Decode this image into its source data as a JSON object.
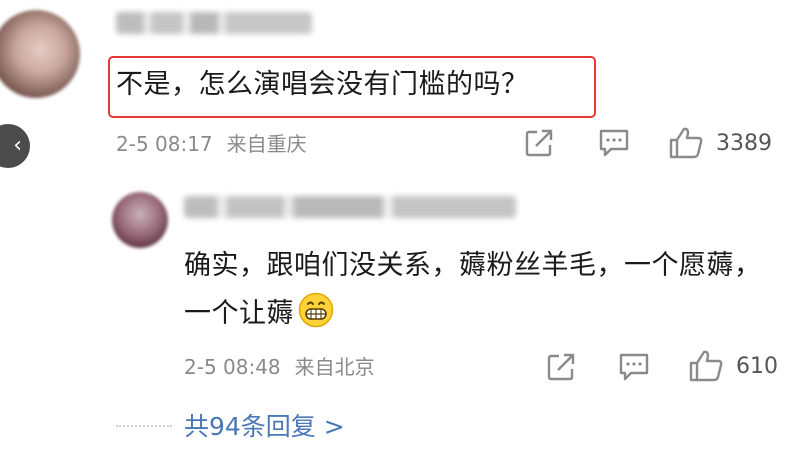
{
  "comment": {
    "text": "不是，怎么演唱会没有门槛的吗？",
    "date": "2-5 08:17",
    "location": "来自重庆",
    "like_count": "3389",
    "highlight_color": "#e53935"
  },
  "reply": {
    "text": "确实，跟咱们没关系，薅粉丝羊毛，一个愿薅，一个让薅",
    "emoji": "grinning-face",
    "date": "2-5 08:48",
    "location": "来自北京",
    "like_count": "610"
  },
  "more_replies_label": "共94条回复 >",
  "colors": {
    "meta_text": "#8a8a8a",
    "link": "#4a77b8"
  }
}
